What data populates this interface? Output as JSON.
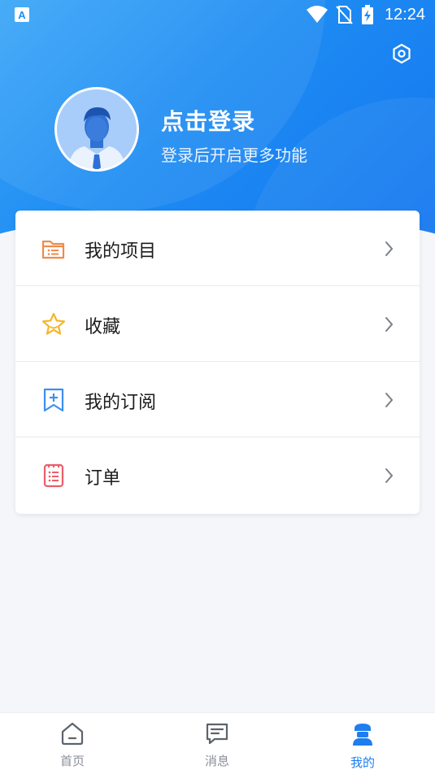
{
  "status_bar": {
    "time": "12:24",
    "left_icon": "A",
    "icons": [
      "wifi-icon",
      "no-sim-icon",
      "battery-charging-icon"
    ]
  },
  "header": {
    "settings_icon": "gear-icon",
    "avatar_icon": "user-avatar-icon",
    "title": "点击登录",
    "subtitle": "登录后开启更多功能"
  },
  "menu": {
    "items": [
      {
        "label": "我的项目",
        "icon": "folder-list-icon",
        "color": "#f08a4b"
      },
      {
        "label": "收藏",
        "icon": "star-icon",
        "color": "#f5b62a"
      },
      {
        "label": "我的订阅",
        "icon": "bookmark-plus-icon",
        "color": "#3d8ff0"
      },
      {
        "label": "订单",
        "icon": "clipboard-list-icon",
        "color": "#ec5d6a"
      }
    ]
  },
  "bottom_nav": {
    "items": [
      {
        "label": "首页",
        "icon": "home-icon",
        "active": false
      },
      {
        "label": "消息",
        "icon": "message-icon",
        "active": false
      },
      {
        "label": "我的",
        "icon": "profile-icon",
        "active": true
      }
    ]
  },
  "colors": {
    "brand": "#1e7ef0",
    "header_start": "#3aa6f7",
    "header_end": "#1476ef",
    "background": "#f4f6fa"
  }
}
